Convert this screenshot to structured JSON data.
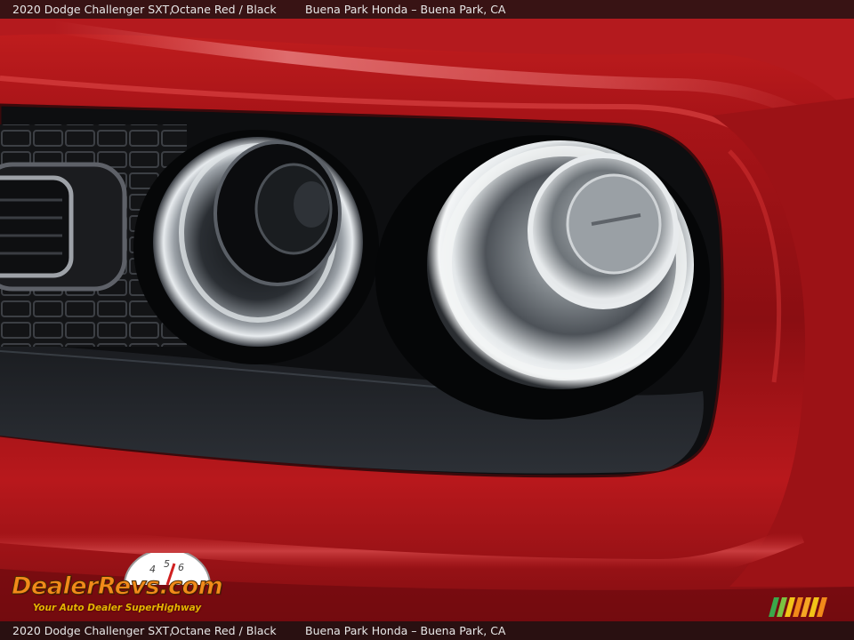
{
  "caption": {
    "vehicle": "2020 Dodge Challenger SXT,",
    "color": "Octane Red / Black",
    "dealer": "Buena Park Honda – Buena Park, CA"
  },
  "watermark": {
    "logo_text": "DealerRevs.com",
    "tagline": "Your Auto Dealer SuperHighway",
    "dial_digits": [
      "4",
      "5",
      "6"
    ]
  },
  "colors": {
    "paint_red": "#c01818",
    "paint_dark": "#5a0a0c",
    "trim_black": "#141416",
    "logo_orange": "#f28a1a",
    "tagline_yellow": "#e6b400"
  }
}
